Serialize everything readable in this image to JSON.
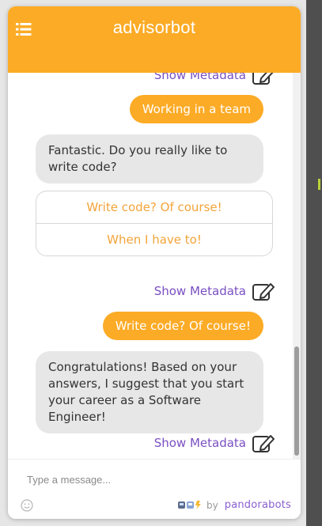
{
  "header": {
    "title": "advisorbot",
    "menu_icon": "list-menu-icon"
  },
  "colors": {
    "accent": "#fcab26",
    "bot_bubble": "#e7e7e7",
    "metadata_link": "#7a4fc2",
    "option_text": "#f3a43a"
  },
  "messages": {
    "meta_label": "Show Metadata",
    "user_1": "Working in a team",
    "bot_1": "Fantastic. Do you really like to write code?",
    "options": [
      "Write code? Of course!",
      "When I have to!"
    ],
    "user_2": "Write code? Of course!",
    "bot_2": "Congratulations! Based on your answers, I suggest that you start your career as a Software Engineer!"
  },
  "input": {
    "placeholder": "Type a message...",
    "value": ""
  },
  "footer": {
    "by_label": "by",
    "brand": "pandorabots",
    "emoji_icon": "smiley-icon",
    "robots_icon": "robots-icon"
  }
}
